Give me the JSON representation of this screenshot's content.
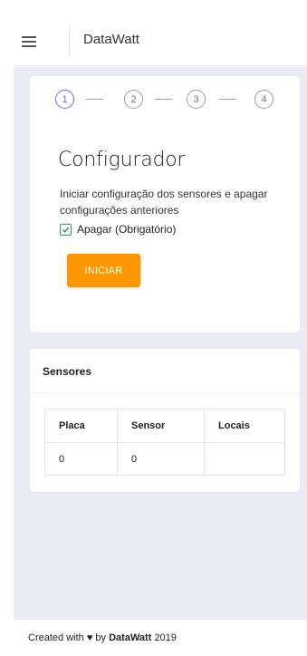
{
  "header": {
    "brand": "DataWatt"
  },
  "stepper": {
    "steps": [
      "1",
      "2",
      "3",
      "4"
    ],
    "active": 1
  },
  "configurator": {
    "title": "Configurador",
    "description": "Iniciar configuração dos sensores e apagar configurações anteriores",
    "checkbox_label": "Apagar (Obrigatório)",
    "checkbox_checked": true,
    "button_label": "INICIAR"
  },
  "sensors": {
    "title": "Sensores",
    "columns": [
      "Placa",
      "Sensor",
      "Locais"
    ],
    "rows": [
      [
        "0",
        "0",
        ""
      ]
    ]
  },
  "footer": {
    "prefix": "Created with",
    "heart": "♥",
    "by": "by",
    "brand": "DataWatt",
    "year": "2019"
  },
  "colors": {
    "accent": "#ff9800",
    "step_active": "#7b61ff",
    "check": "#2e9e4a",
    "background": "#e9ecf5"
  }
}
